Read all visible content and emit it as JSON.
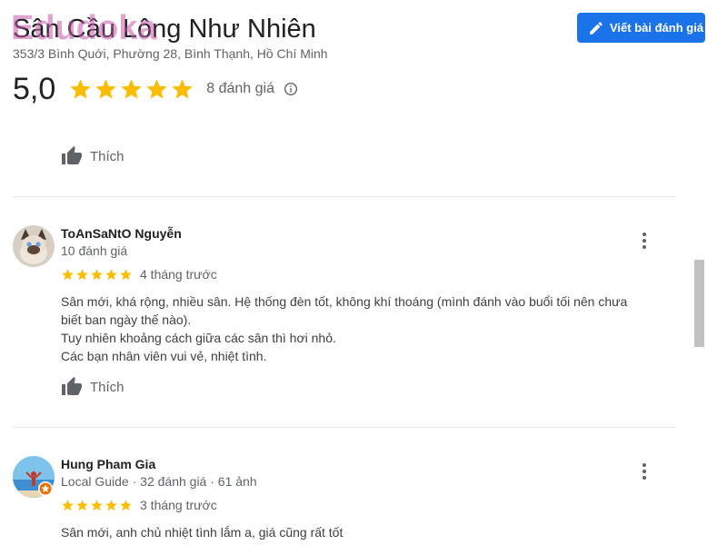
{
  "watermark": "Edudoka",
  "place": {
    "title": "Sân Cầu Lông Như Nhiên",
    "address": "353/3 Bình Quới, Phường 28, Bình Thạnh, Hồ Chí Minh",
    "rating": "5,0",
    "rating_stars": 5,
    "review_count": "8 đánh giá",
    "info_icon": "info-icon"
  },
  "actions": {
    "write_review_label": "Viết bài đánh giá",
    "write_review_icon": "pencil-icon"
  },
  "colors": {
    "star": "#fbbc04",
    "primary_button": "#1a73e8",
    "watermark": "#c45aaa"
  },
  "previous_review_like": "Thích",
  "reviews": [
    {
      "name": "ToAnSaNtO Nguyễn",
      "meta": "10 đánh giá",
      "stars": 5,
      "time": "4 tháng trước",
      "text": [
        "Sân mới, khá rộng, nhiều sân. Hệ thống đèn tốt, không khí thoáng (mình đánh vào buổi tối nên chưa",
        "biết ban ngày thế nào).",
        "Tuy nhiên khoảng cách giữa các sân thì hơi nhỏ.",
        "Các bạn nhân viên vui vẻ, nhiệt tình."
      ],
      "like_label": "Thích",
      "avatar_icon": "cat-avatar-icon"
    },
    {
      "name": "Hung Pham Gia",
      "meta": "Local Guide · 32 đánh giá · 61 ảnh",
      "stars": 5,
      "time": "3 tháng trước",
      "text": [
        "Sân mới, anh chủ nhiệt tình lắm a, giá cũng rất tốt"
      ],
      "avatar_icon": "beach-avatar-icon",
      "badge_icon": "local-guide-star-icon"
    }
  ]
}
